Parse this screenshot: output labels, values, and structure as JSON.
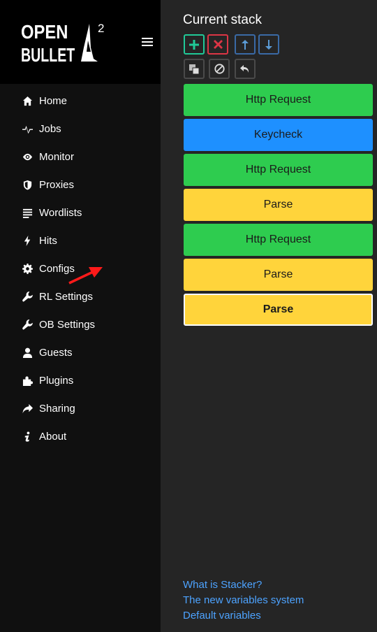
{
  "brand": {
    "line1": "OPEN",
    "line2": "BULLET",
    "version": "2"
  },
  "nav": {
    "items": [
      {
        "label": "Home",
        "icon": "home-icon"
      },
      {
        "label": "Jobs",
        "icon": "pulse-icon"
      },
      {
        "label": "Monitor",
        "icon": "eye-icon"
      },
      {
        "label": "Proxies",
        "icon": "shield-icon"
      },
      {
        "label": "Wordlists",
        "icon": "list-icon"
      },
      {
        "label": "Hits",
        "icon": "lightning-icon"
      },
      {
        "label": "Configs",
        "icon": "gear-icon"
      },
      {
        "label": "RL Settings",
        "icon": "wrench-icon"
      },
      {
        "label": "OB Settings",
        "icon": "wrench-icon"
      },
      {
        "label": "Guests",
        "icon": "user-icon"
      },
      {
        "label": "Plugins",
        "icon": "puzzle-icon"
      },
      {
        "label": "Sharing",
        "icon": "share-icon"
      },
      {
        "label": "About",
        "icon": "info-icon"
      }
    ]
  },
  "main": {
    "title": "Current stack",
    "toolbar": {
      "add": "add-icon",
      "remove": "remove-icon",
      "move_up": "arrow-up-icon",
      "move_down": "arrow-down-icon",
      "clone": "clone-icon",
      "disable": "disable-icon",
      "undo": "undo-icon"
    },
    "blocks": [
      {
        "label": "Http Request",
        "color": "#2ecc4f",
        "selected": false
      },
      {
        "label": "Keycheck",
        "color": "#1e90ff",
        "selected": false
      },
      {
        "label": "Http Request",
        "color": "#2ecc4f",
        "selected": false
      },
      {
        "label": "Parse",
        "color": "#ffd43b",
        "selected": false
      },
      {
        "label": "Http Request",
        "color": "#2ecc4f",
        "selected": false
      },
      {
        "label": "Parse",
        "color": "#ffd43b",
        "selected": false
      },
      {
        "label": "Parse",
        "color": "#ffd43b",
        "selected": true
      }
    ],
    "links": [
      "What is Stacker?",
      "The new variables system",
      "Default variables"
    ]
  },
  "colors": {
    "accent_link": "#4da3ff",
    "sidebar_bg": "#101010",
    "main_bg": "#252525",
    "annotation_arrow": "#ff1a1a"
  }
}
